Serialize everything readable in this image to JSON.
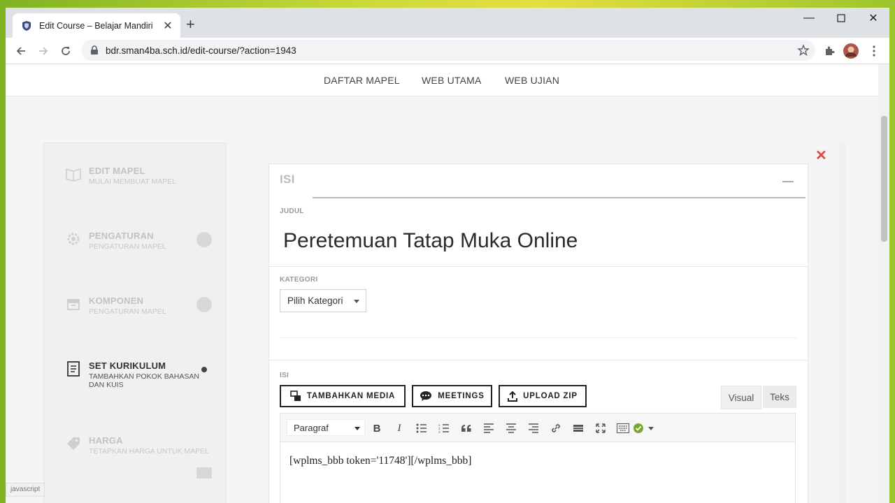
{
  "browser": {
    "tab_title": "Edit Course – Belajar Mandiri",
    "url": "bdr.sman4ba.sch.id/edit-course/?action=1943"
  },
  "topnav": {
    "items": [
      "DAFTAR MAPEL",
      "WEB UTAMA",
      "WEB UJIAN"
    ]
  },
  "sidebar": {
    "items": [
      {
        "title": "EDIT MAPEL",
        "subtitle": "MULAI MEMBUAT MAPEL"
      },
      {
        "title": "PENGATURAN",
        "subtitle": "PENGATURAN MAPEL"
      },
      {
        "title": "KOMPONEN",
        "subtitle": "PENGATURAN MAPEL"
      },
      {
        "title": "SET KURIKULUM",
        "subtitle": "TAMBAHKAN POKOK BAHASAN DAN KUIS"
      },
      {
        "title": "HARGA",
        "subtitle": "TETAPKAN HARGA UNTUK MAPEL"
      }
    ]
  },
  "main": {
    "section_label": "ISI",
    "judul_label": "JUDUL",
    "title": "Peretemuan Tatap Muka Online",
    "kategori_label": "KATEGORI",
    "kategori_value": "Pilih Kategori",
    "isi_label": "ISI",
    "buttons": {
      "media": "TAMBAHKAN MEDIA",
      "meetings": "MEETINGS",
      "upload": "UPLOAD ZIP"
    },
    "tabs": {
      "visual": "Visual",
      "teks": "Teks"
    },
    "format_select": "Paragraf",
    "editor_content": "[wplms_bbb token='11748'][/wplms_bbb]"
  },
  "statusbar": "javascript",
  "colors": {
    "accent_close": "#e04b3c"
  }
}
